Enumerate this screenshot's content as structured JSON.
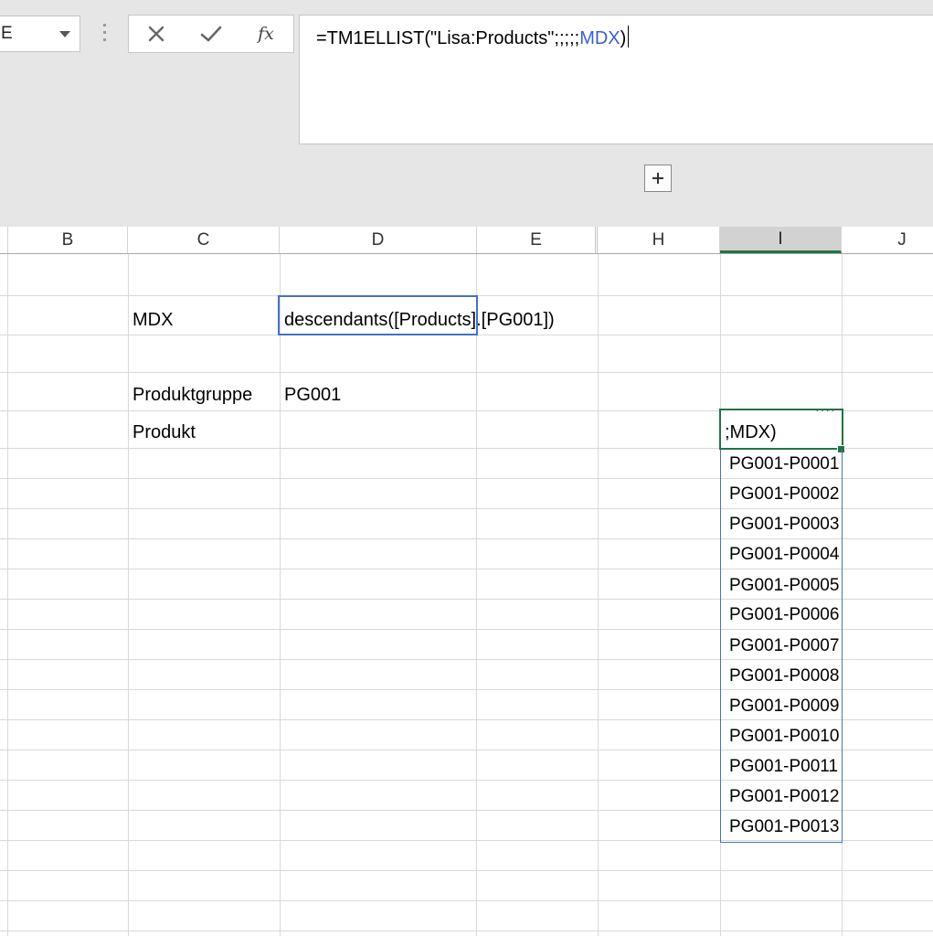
{
  "name_box": {
    "value": "E"
  },
  "formula_bar": {
    "cancel_icon": "x-icon",
    "enter_icon": "check-icon",
    "fx_label": "fx",
    "formula_prefix": "=TM1ELLIST(\"Lisa:Products\";;;;;",
    "formula_ref": "MDX",
    "formula_suffix": ")"
  },
  "expand_button": {
    "icon": "plus-icon"
  },
  "columns": [
    "B",
    "C",
    "D",
    "E",
    "H",
    "I",
    "J"
  ],
  "active_column": "I",
  "cells": {
    "c_mdx_label": "MDX",
    "d_mdx_value": "descendants([Products].[PG001])",
    "c_group_label": "Produktgruppe",
    "d_group_value": "PG001",
    "c_product_label": "Produkt",
    "i_active_edit": ";MDX)"
  },
  "spill_list": [
    "PG001-P0001",
    "PG001-P0002",
    "PG001-P0003",
    "PG001-P0004",
    "PG001-P0005",
    "PG001-P0006",
    "PG001-P0007",
    "PG001-P0008",
    "PG001-P0009",
    "PG001-P0010",
    "PG001-P0011",
    "PG001-P0012",
    "PG001-P0013"
  ],
  "colors": {
    "reference_blue": "#3c5fc7",
    "active_green": "#217346",
    "selection_blue": "#4472c4"
  }
}
